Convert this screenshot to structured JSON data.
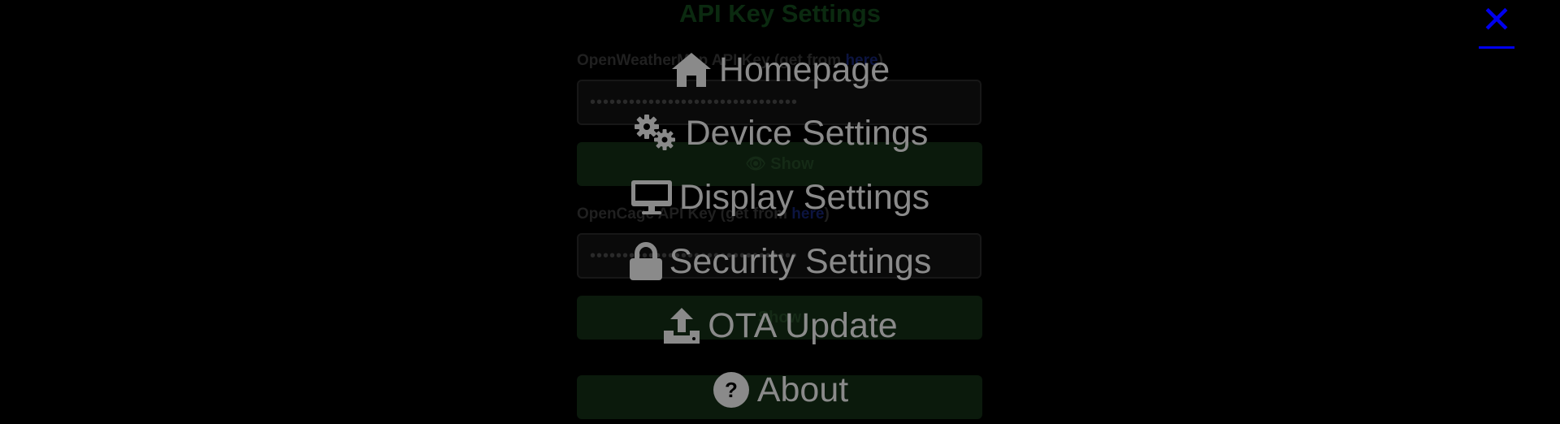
{
  "background": {
    "title": "API Key Settings",
    "fields": [
      {
        "label_prefix": "OpenWeatherMap API Key (get from ",
        "label_link": "here",
        "label_suffix": ")",
        "masked_value": "••••••••••••••••••••••••••••••••",
        "button_label": "Show"
      },
      {
        "label_prefix": "OpenCage API Key (get from ",
        "label_link": "here",
        "label_suffix": ")",
        "masked_value": "••••••••••••••••••••••••••••••••",
        "button_label": "Show"
      }
    ],
    "extra_button_label": ""
  },
  "menu": {
    "close_label": "✕",
    "items": [
      {
        "label": "Homepage",
        "icon": "home-icon"
      },
      {
        "label": "Device Settings",
        "icon": "gears-icon"
      },
      {
        "label": "Display Settings",
        "icon": "monitor-icon"
      },
      {
        "label": "Security Settings",
        "icon": "lock-icon"
      },
      {
        "label": "OTA Update",
        "icon": "upload-icon"
      },
      {
        "label": "About",
        "icon": "question-circle-icon"
      }
    ]
  },
  "colors": {
    "overlay_text": "#8a8a8a",
    "close": "#0000ee",
    "background": "#000000"
  }
}
